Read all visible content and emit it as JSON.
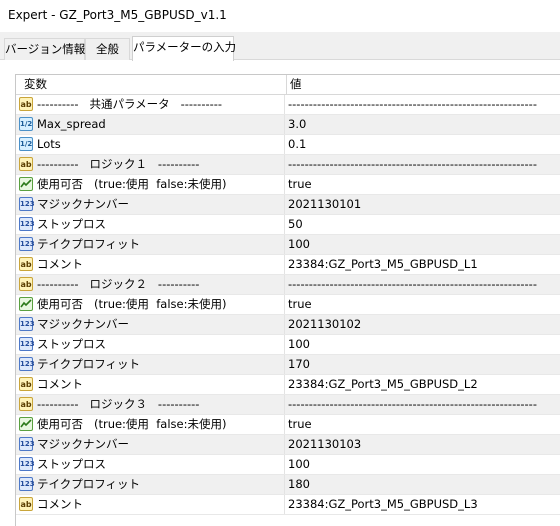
{
  "window": {
    "title": "Expert - GZ_Port3_M5_GBPUSD_v1.1"
  },
  "tabs": [
    {
      "label": "バージョン情報"
    },
    {
      "label": "全般"
    },
    {
      "label": "パラメーターの入力"
    }
  ],
  "table": {
    "header": {
      "name": "変数",
      "value": "値"
    },
    "rows": [
      {
        "icon": "ab-icon",
        "name": "----------   共通パラメータ   ----------",
        "value": "------------------------------------------------------------"
      },
      {
        "icon": "double-icon",
        "name": "Max_spread",
        "value": "3.0"
      },
      {
        "icon": "double-icon",
        "name": "Lots",
        "value": "0.1"
      },
      {
        "icon": "ab-icon",
        "name": "----------   ロジック１   ----------",
        "value": "------------------------------------------------------------"
      },
      {
        "icon": "bool-icon",
        "name": "使用可否   (true:使用  false:未使用)",
        "value": "true"
      },
      {
        "icon": "int-icon",
        "name": "マジックナンバー",
        "value": "2021130101"
      },
      {
        "icon": "int-icon",
        "name": "ストップロス",
        "value": "50"
      },
      {
        "icon": "int-icon",
        "name": "テイクプロフィット",
        "value": "100"
      },
      {
        "icon": "ab-icon",
        "name": "コメント",
        "value": "23384:GZ_Port3_M5_GBPUSD_L1"
      },
      {
        "icon": "ab-icon",
        "name": "----------   ロジック２   ----------",
        "value": "------------------------------------------------------------"
      },
      {
        "icon": "bool-icon",
        "name": "使用可否   (true:使用  false:未使用)",
        "value": "true"
      },
      {
        "icon": "int-icon",
        "name": "マジックナンバー",
        "value": "2021130102"
      },
      {
        "icon": "int-icon",
        "name": "ストップロス",
        "value": "100"
      },
      {
        "icon": "int-icon",
        "name": "テイクプロフィット",
        "value": "170"
      },
      {
        "icon": "ab-icon",
        "name": "コメント",
        "value": "23384:GZ_Port3_M5_GBPUSD_L2"
      },
      {
        "icon": "ab-icon",
        "name": "----------   ロジック３   ----------",
        "value": "------------------------------------------------------------"
      },
      {
        "icon": "bool-icon",
        "name": "使用可否   (true:使用  false:未使用)",
        "value": "true"
      },
      {
        "icon": "int-icon",
        "name": "マジックナンバー",
        "value": "2021130103"
      },
      {
        "icon": "int-icon",
        "name": "ストップロス",
        "value": "100"
      },
      {
        "icon": "int-icon",
        "name": "テイクプロフィット",
        "value": "180"
      },
      {
        "icon": "ab-icon",
        "name": "コメント",
        "value": "23384:GZ_Port3_M5_GBPUSD_L3"
      }
    ]
  },
  "icon_glyphs": {
    "ab-icon": "ab",
    "double-icon": "1/2",
    "int-icon": "123",
    "bool-icon": ""
  },
  "colors": {
    "row_alt": "#f0f0f0",
    "grid_line": "#d8d8d8"
  }
}
